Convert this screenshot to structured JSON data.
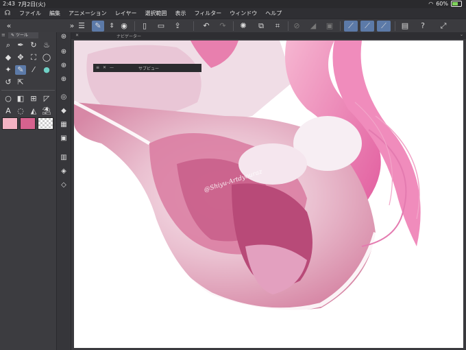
{
  "status": {
    "time": "2:43",
    "date": "7月2日(火)",
    "battery": "60%"
  },
  "menu": {
    "logo": "☊",
    "items": [
      "ファイル",
      "編集",
      "アニメーション",
      "レイヤー",
      "選択範囲",
      "表示",
      "フィルター",
      "ウィンドウ",
      "ヘルプ"
    ]
  },
  "toolpanel": {
    "tab_label": "ツール"
  },
  "navigator": {
    "tab_label": "ナビゲーター",
    "close": "✕",
    "collapse": "⌄"
  },
  "subview": {
    "tab_label": "サブビュー",
    "close": "✕",
    "minimize": "—"
  },
  "canvas": {
    "watermark": "@Shiyu-Artdyouraz"
  },
  "colors": {
    "main_color": "#f3b3c3",
    "sub_color": "#d6628e",
    "accent": "#5c7aa8"
  }
}
